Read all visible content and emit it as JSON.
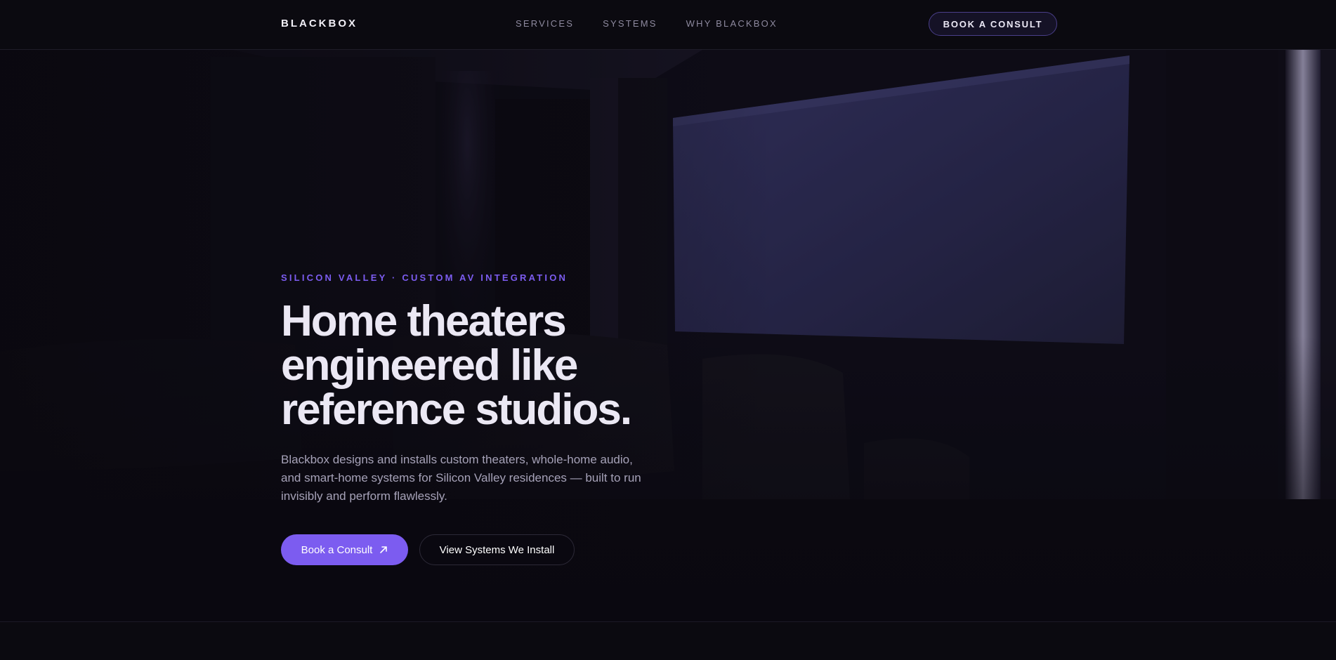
{
  "nav": {
    "brand": "BLACKBOX",
    "links": [
      "SERVICES",
      "SYSTEMS",
      "WHY BLACKBOX"
    ],
    "cta": "BOOK A CONSULT"
  },
  "hero": {
    "eyebrow": "SILICON VALLEY · CUSTOM AV INTEGRATION",
    "headline_lines": [
      "Home theaters",
      "engineered like",
      "reference studios."
    ],
    "subtext": "Blackbox designs and installs custom theaters, whole-home audio, and smart-home systems for Silicon Valley residences — built to run invisibly and perform flawlessly.",
    "primary_button": "Book a Consult",
    "primary_icon": "arrow-up-right-icon",
    "secondary_button": "View Systems We Install",
    "background": "home-theater-room-photo"
  },
  "colors": {
    "accent": "#7c5cf0",
    "background": "#0a0910",
    "heading": "#ebe8f4",
    "muted": "#a6a2b8"
  }
}
